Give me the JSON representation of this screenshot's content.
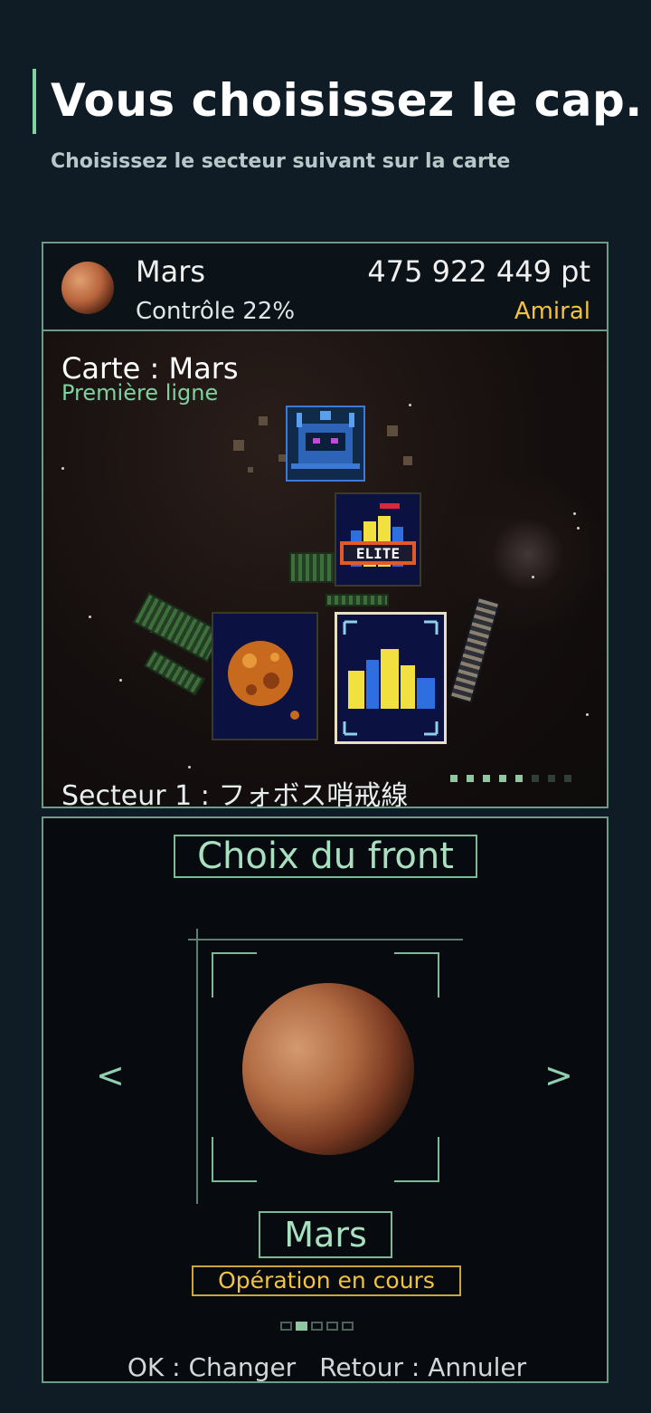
{
  "header": {
    "title": "Vous choisissez le cap.",
    "subtitle": "Choisissez le secteur suivant sur la carte"
  },
  "status": {
    "planet_name": "Mars",
    "control": "Contrôle 22%",
    "score": "475 922 449 pt",
    "rank": "Amiral"
  },
  "map": {
    "title": "Carte : Mars",
    "subtitle": "Première ligne",
    "elite_label": "ELITE",
    "sector": "Secteur 1 : フォボス哨戒線"
  },
  "selection": {
    "title": "Choix du front",
    "prev_arrow": "<",
    "next_arrow": ">",
    "planet_name": "Mars",
    "status": "Opération en cours",
    "controls": {
      "ok": "OK : Changer",
      "back": "Retour : Annuler"
    },
    "page_index": 2,
    "page_count": 5
  },
  "colors": {
    "accent": "#7fd1a0",
    "gold": "#f2c341",
    "panel_border": "#6f9a86",
    "background": "#0f1c26"
  }
}
